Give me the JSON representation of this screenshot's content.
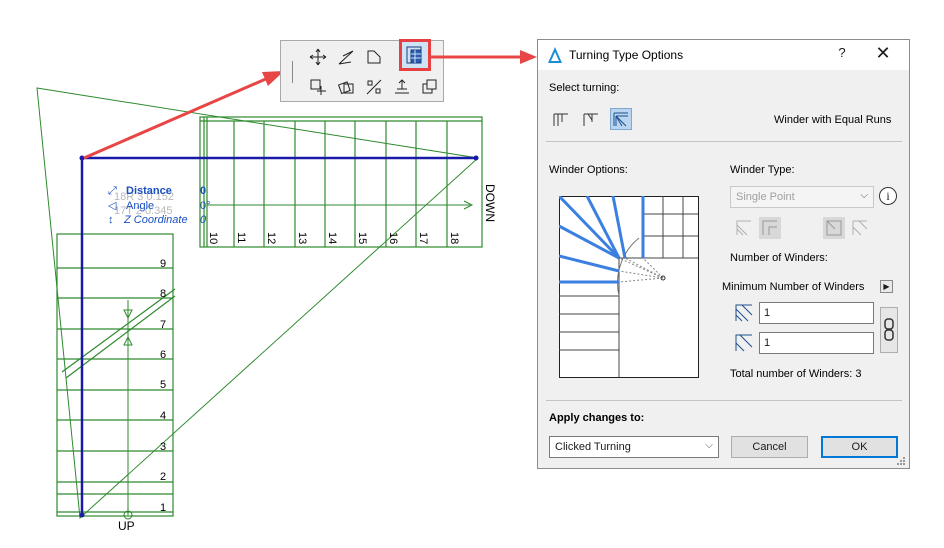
{
  "drawing": {
    "tracker": {
      "distance_label": "Distance",
      "distance_value": "0",
      "angle_label": "Angle",
      "angle_value": "0°",
      "zcoord_label": "Z Coordinate",
      "zcoord_value": "0",
      "ghost_1": "18R 3 0.152",
      "ghost_2": "17T 2 0.345"
    },
    "vertical_steps": [
      "9",
      "8",
      "7",
      "6",
      "5",
      "4",
      "3",
      "2",
      "1"
    ],
    "horizontal_steps": [
      "10",
      "11",
      "12",
      "13",
      "14",
      "15",
      "16",
      "17",
      "18"
    ],
    "up_label": "UP",
    "down_label": "DOWN",
    "colors": {
      "stair_line": "#2d8a2d",
      "walking_line": "#1a1aa8",
      "arrow": "#e84545"
    }
  },
  "toolbar": {
    "icons": [
      "move-icon",
      "rotate-icon",
      "edit-corner-icon",
      "turning-type-icon",
      "multiply-icon",
      "rotate-copy-icon",
      "offset-icon",
      "elevate-icon",
      "copy-icon"
    ]
  },
  "dialog": {
    "title": "Turning Type Options",
    "help": "?",
    "close": "✕",
    "select_turning_label": "Select turning:",
    "turning_type_name": "Winder with Equal Runs",
    "winder_options_label": "Winder Options:",
    "winder_type_label": "Winder Type:",
    "winder_type_value": "Single Point",
    "number_of_winders_label": "Number of Winders:",
    "number_mode_value": "Minimum Number of Winders",
    "winder_count_1": "1",
    "winder_count_2": "1",
    "total_winders_label": "Total number of Winders: 3",
    "apply_label": "Apply changes to:",
    "apply_value": "Clicked Turning",
    "cancel_label": "Cancel",
    "ok_label": "OK",
    "accent_color": "#0078d7"
  }
}
